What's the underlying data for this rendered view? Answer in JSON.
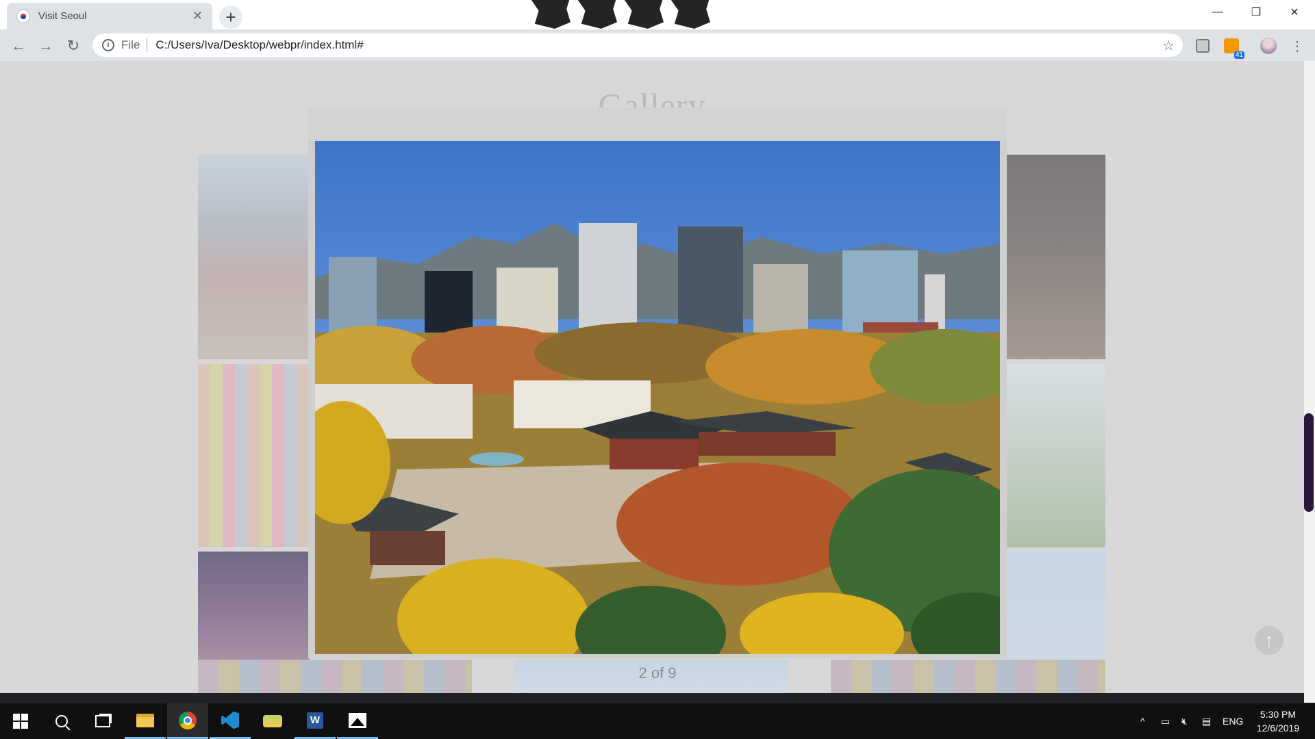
{
  "browser": {
    "tab_title": "Visit Seoul",
    "tab_close": "✕",
    "new_tab": "+",
    "address_scheme": "File",
    "address_url": "C:/Users/Iva/Desktop/webpr/index.html#",
    "rss_badge": "41",
    "window_controls": {
      "minimize": "—",
      "restore": "❐",
      "close": "✕"
    }
  },
  "page": {
    "title": "Gallery",
    "lightbox": {
      "caption": "2 of 9",
      "image_subject": "Aerial view of a Seoul palace surrounded by autumn trees and city skyscrapers"
    },
    "scroll_top_icon": "↑"
  },
  "taskbar": {
    "language": "ENG",
    "time": "5:30 PM",
    "date": "12/6/2019",
    "word_label": "W",
    "tray_up": "^"
  },
  "colors": {
    "accent_purple": "#2b1640",
    "overlay_gray": "#d8d8d8",
    "chrome_toolbar": "#dee1e6",
    "taskbar": "#101010"
  }
}
